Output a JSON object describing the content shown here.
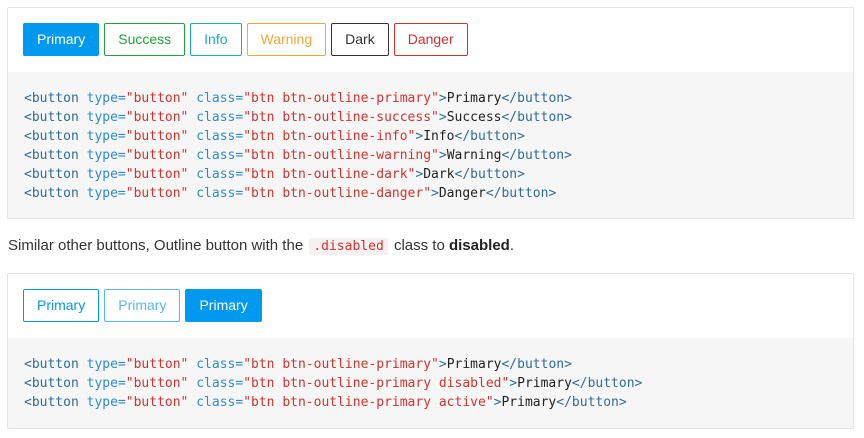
{
  "example1": {
    "buttons": [
      {
        "label": "Primary",
        "variant": "primary-solid"
      },
      {
        "label": "Success",
        "variant": "outline-success"
      },
      {
        "label": "Info",
        "variant": "outline-info"
      },
      {
        "label": "Warning",
        "variant": "outline-warning"
      },
      {
        "label": "Dark",
        "variant": "outline-dark"
      },
      {
        "label": "Danger",
        "variant": "outline-danger"
      }
    ],
    "code_lines": [
      {
        "tag_open": "<button",
        "attr1": " type=",
        "val1": "\"button\"",
        "attr2": " class=",
        "val2": "\"btn btn-outline-primary\"",
        "gt": ">",
        "text": "Primary",
        "tag_close": "</button>"
      },
      {
        "tag_open": "<button",
        "attr1": " type=",
        "val1": "\"button\"",
        "attr2": " class=",
        "val2": "\"btn btn-outline-success\"",
        "gt": ">",
        "text": "Success",
        "tag_close": "</button>"
      },
      {
        "tag_open": "<button",
        "attr1": " type=",
        "val1": "\"button\"",
        "attr2": " class=",
        "val2": "\"btn btn-outline-info\"",
        "gt": ">",
        "text": "Info",
        "tag_close": "</button>"
      },
      {
        "tag_open": "<button",
        "attr1": " type=",
        "val1": "\"button\"",
        "attr2": " class=",
        "val2": "\"btn btn-outline-warning\"",
        "gt": ">",
        "text": "Warning",
        "tag_close": "</button>"
      },
      {
        "tag_open": "<button",
        "attr1": " type=",
        "val1": "\"button\"",
        "attr2": " class=",
        "val2": "\"btn btn-outline-dark\"",
        "gt": ">",
        "text": "Dark",
        "tag_close": "</button>"
      },
      {
        "tag_open": "<button",
        "attr1": " type=",
        "val1": "\"button\"",
        "attr2": " class=",
        "val2": "\"btn btn-outline-danger\"",
        "gt": ">",
        "text": "Danger",
        "tag_close": "</button>"
      }
    ]
  },
  "description": {
    "before": "Similar other buttons, Outline button with the ",
    "code": ".disabled",
    "middle": " class to ",
    "bold": "disabled",
    "after": "."
  },
  "example2": {
    "buttons": [
      {
        "label": "Primary",
        "variant": "outline-primary"
      },
      {
        "label": "Primary",
        "variant": "outline-primary disabled"
      },
      {
        "label": "Primary",
        "variant": "outline-primary active"
      }
    ],
    "code_lines": [
      {
        "tag_open": "<button",
        "attr1": " type=",
        "val1": "\"button\"",
        "attr2": " class=",
        "val2": "\"btn btn-outline-primary\"",
        "gt": ">",
        "text": "Primary",
        "tag_close": "</button>"
      },
      {
        "tag_open": "<button",
        "attr1": " type=",
        "val1": "\"button\"",
        "attr2": " class=",
        "val2": "\"btn btn-outline-primary disabled\"",
        "gt": ">",
        "text": "Primary",
        "tag_close": "</button>"
      },
      {
        "tag_open": "<button",
        "attr1": " type=",
        "val1": "\"button\"",
        "attr2": " class=",
        "val2": "\"btn btn-outline-primary active\"",
        "gt": ">",
        "text": "Primary",
        "tag_close": "</button>"
      }
    ]
  },
  "colors": {
    "primary": "#0099ef",
    "success": "#21a33a",
    "info": "#17a8cf",
    "warning": "#f5a637",
    "dark": "#333333",
    "danger": "#d3302f"
  }
}
